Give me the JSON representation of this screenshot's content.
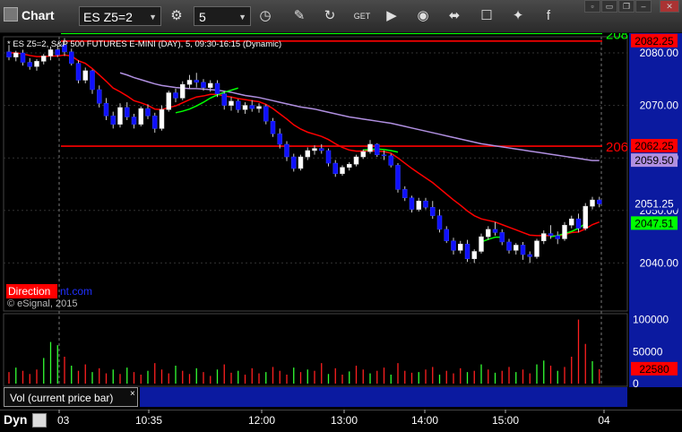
{
  "toolbar": {
    "title": "Chart",
    "symbol": "ES Z5=2",
    "interval": "5",
    "buttons": [
      {
        "name": "settings-icon",
        "glyph": "⚙"
      },
      {
        "name": "clock-icon",
        "glyph": "◷"
      },
      {
        "name": "pencil-icon",
        "glyph": "✎"
      },
      {
        "name": "refresh-icon",
        "glyph": "↻"
      },
      {
        "name": "get-icon",
        "glyph": "GET"
      },
      {
        "name": "play-icon",
        "glyph": "▶"
      },
      {
        "name": "camera-icon",
        "glyph": "◉"
      },
      {
        "name": "link-icon",
        "glyph": "⬌"
      },
      {
        "name": "comment-icon",
        "glyph": "☐"
      },
      {
        "name": "twitter-icon",
        "glyph": "✦"
      },
      {
        "name": "facebook-icon",
        "glyph": "f"
      }
    ]
  },
  "colors": {
    "price_axis_bg": "#0b1aa0",
    "red_line": "#ff0000",
    "green_line": "#00ff00",
    "purple_line": "#b08fe0",
    "candle_up": "#ffffff",
    "candle_down": "#1010ff"
  },
  "chart_data": {
    "type": "candlestick",
    "title": "* ES Z5=2, S&P 500 FUTURES E-MINI (DAY), 5, 09:30-16:15 (Dynamic)",
    "watermark": "© eSignal, 2015",
    "branding": "Direction",
    "branding_suffix": "nt.com",
    "x_ticks": [
      "03",
      "10:35",
      "12:00",
      "13:00",
      "14:00",
      "15:00",
      "04"
    ],
    "y_ticks": [
      "2080.00",
      "2070.00",
      "2060.00",
      "2050.00",
      "2040.00"
    ],
    "ylim": [
      2038,
      2085
    ],
    "horizontal_lines": [
      {
        "value": 2083.7,
        "color": "#00ff00",
        "label": "208"
      },
      {
        "value": 2082.25,
        "color": "#ff0000",
        "label": "2082.25"
      },
      {
        "value": 2062.25,
        "color": "#ff0000",
        "label": "206"
      }
    ],
    "price_labels": [
      {
        "text": "2082.25",
        "value": 2082.25,
        "bg": "#ff0000",
        "fg": "#000000"
      },
      {
        "text": "2062.25",
        "value": 2062.25,
        "bg": "#ff0000",
        "fg": "#000000"
      },
      {
        "text": "2059.50",
        "value": 2059.5,
        "bg": "#b08fe0",
        "fg": "#000000"
      },
      {
        "text": "2051.25",
        "value": 2051.25,
        "bg": "#0b1aa0",
        "fg": "#ffffff"
      },
      {
        "text": "2047.51",
        "value": 2047.51,
        "bg": "#00ff00",
        "fg": "#000000"
      }
    ],
    "candles": [
      [
        2080.2,
        2081.5,
        2078.6,
        2079.2
      ],
      [
        2079.2,
        2080.4,
        2078.4,
        2080.0
      ],
      [
        2080.0,
        2080.6,
        2077.6,
        2078.2
      ],
      [
        2078.2,
        2079.0,
        2076.8,
        2077.4
      ],
      [
        2077.4,
        2078.8,
        2076.6,
        2078.4
      ],
      [
        2078.4,
        2079.8,
        2077.8,
        2079.4
      ],
      [
        2079.4,
        2081.2,
        2078.6,
        2080.6
      ],
      [
        2080.6,
        2081.4,
        2079.2,
        2079.6
      ],
      [
        2081.5,
        2082.8,
        2079.4,
        2080.2
      ],
      [
        2080.2,
        2080.8,
        2077.6,
        2078.0
      ],
      [
        2078.0,
        2078.6,
        2074.2,
        2074.8
      ],
      [
        2074.8,
        2077.2,
        2074.2,
        2076.6
      ],
      [
        2076.6,
        2076.8,
        2072.2,
        2073.0
      ],
      [
        2073.0,
        2073.8,
        2069.6,
        2070.4
      ],
      [
        2070.4,
        2071.4,
        2067.2,
        2068.0
      ],
      [
        2068.0,
        2068.8,
        2065.6,
        2066.4
      ],
      [
        2066.4,
        2070.4,
        2065.8,
        2069.6
      ],
      [
        2069.6,
        2070.6,
        2067.2,
        2067.8
      ],
      [
        2067.8,
        2068.4,
        2065.6,
        2066.4
      ],
      [
        2066.4,
        2069.8,
        2066.0,
        2069.4
      ],
      [
        2069.4,
        2070.2,
        2067.4,
        2068.0
      ],
      [
        2068.0,
        2068.6,
        2064.8,
        2065.6
      ],
      [
        2065.6,
        2070.0,
        2065.2,
        2069.2
      ],
      [
        2069.2,
        2072.8,
        2068.8,
        2072.4
      ],
      [
        2072.4,
        2073.2,
        2070.6,
        2071.4
      ],
      [
        2071.4,
        2074.6,
        2071.0,
        2074.0
      ],
      [
        2074.0,
        2075.8,
        2073.2,
        2074.8
      ],
      [
        2074.8,
        2076.2,
        2073.4,
        2074.4
      ],
      [
        2074.4,
        2075.0,
        2072.8,
        2073.4
      ],
      [
        2073.4,
        2074.8,
        2072.6,
        2074.2
      ],
      [
        2074.2,
        2074.8,
        2071.6,
        2072.2
      ],
      [
        2072.2,
        2072.6,
        2069.2,
        2070.0
      ],
      [
        2070.0,
        2071.6,
        2069.0,
        2070.8
      ],
      [
        2070.8,
        2071.2,
        2068.6,
        2069.2
      ],
      [
        2069.2,
        2070.6,
        2068.4,
        2070.0
      ],
      [
        2070.0,
        2071.0,
        2068.8,
        2069.4
      ],
      [
        2069.4,
        2070.4,
        2068.6,
        2069.8
      ],
      [
        2069.8,
        2070.2,
        2066.4,
        2067.0
      ],
      [
        2067.0,
        2067.6,
        2064.0,
        2064.6
      ],
      [
        2064.6,
        2065.6,
        2061.8,
        2062.6
      ],
      [
        2062.6,
        2063.2,
        2059.4,
        2060.2
      ],
      [
        2060.2,
        2060.8,
        2057.4,
        2058.0
      ],
      [
        2058.0,
        2060.6,
        2057.6,
        2060.2
      ],
      [
        2060.2,
        2062.0,
        2059.6,
        2061.4
      ],
      [
        2061.4,
        2062.4,
        2060.6,
        2061.8
      ],
      [
        2061.8,
        2062.6,
        2060.8,
        2061.4
      ],
      [
        2061.4,
        2061.8,
        2058.4,
        2059.0
      ],
      [
        2059.0,
        2059.6,
        2056.4,
        2057.0
      ],
      [
        2057.0,
        2058.6,
        2056.6,
        2058.2
      ],
      [
        2058.2,
        2059.2,
        2057.6,
        2058.8
      ],
      [
        2058.8,
        2060.6,
        2058.4,
        2060.2
      ],
      [
        2060.2,
        2061.6,
        2059.8,
        2061.2
      ],
      [
        2061.2,
        2063.4,
        2060.8,
        2062.6
      ],
      [
        2062.6,
        2062.8,
        2060.2,
        2060.6
      ],
      [
        2060.6,
        2061.4,
        2059.6,
        2060.4
      ],
      [
        2060.4,
        2060.8,
        2058.2,
        2058.6
      ],
      [
        2058.6,
        2059.0,
        2053.4,
        2054.0
      ],
      [
        2054.0,
        2054.6,
        2051.8,
        2052.4
      ],
      [
        2052.4,
        2052.8,
        2049.6,
        2050.2
      ],
      [
        2050.2,
        2052.4,
        2049.8,
        2051.8
      ],
      [
        2051.8,
        2052.4,
        2050.2,
        2050.6
      ],
      [
        2050.6,
        2051.8,
        2048.4,
        2049.0
      ],
      [
        2049.0,
        2050.2,
        2045.8,
        2046.4
      ],
      [
        2046.4,
        2047.0,
        2043.8,
        2044.2
      ],
      [
        2044.2,
        2044.8,
        2041.6,
        2042.4
      ],
      [
        2042.4,
        2044.2,
        2041.8,
        2043.6
      ],
      [
        2043.6,
        2044.4,
        2040.2,
        2040.8
      ],
      [
        2040.8,
        2042.6,
        2040.0,
        2042.2
      ],
      [
        2042.2,
        2045.6,
        2041.8,
        2045.0
      ],
      [
        2045.0,
        2047.0,
        2044.4,
        2046.4
      ],
      [
        2046.4,
        2047.8,
        2045.2,
        2045.8
      ],
      [
        2045.8,
        2046.4,
        2043.4,
        2044.0
      ],
      [
        2044.0,
        2044.6,
        2041.8,
        2042.4
      ],
      [
        2042.4,
        2043.8,
        2041.6,
        2043.4
      ],
      [
        2043.4,
        2044.0,
        2040.6,
        2041.6
      ],
      [
        2041.6,
        2042.2,
        2040.0,
        2041.2
      ],
      [
        2041.2,
        2044.6,
        2040.8,
        2044.2
      ],
      [
        2044.2,
        2046.2,
        2043.6,
        2045.6
      ],
      [
        2045.6,
        2047.2,
        2044.6,
        2045.2
      ],
      [
        2045.2,
        2046.0,
        2043.6,
        2044.6
      ],
      [
        2044.6,
        2047.8,
        2044.2,
        2047.2
      ],
      [
        2047.2,
        2049.0,
        2046.6,
        2048.4
      ],
      [
        2048.4,
        2049.4,
        2045.8,
        2046.6
      ],
      [
        2046.6,
        2051.4,
        2046.2,
        2050.8
      ],
      [
        2050.8,
        2052.6,
        2050.2,
        2052.0
      ],
      [
        2052.0,
        2052.6,
        2050.6,
        2051.25
      ]
    ],
    "ema_red": [
      2080.0,
      2080.0,
      2079.8,
      2079.5,
      2079.3,
      2079.3,
      2079.4,
      2079.4,
      2079.6,
      2079.4,
      2078.5,
      2078.0,
      2077.0,
      2075.8,
      2074.6,
      2073.3,
      2072.6,
      2071.8,
      2070.9,
      2070.5,
      2070.0,
      2069.3,
      2069.2,
      2069.6,
      2069.9,
      2070.5,
      2071.1,
      2071.6,
      2071.8,
      2072.1,
      2072.1,
      2071.8,
      2071.6,
      2071.3,
      2071.1,
      2070.9,
      2070.7,
      2070.2,
      2069.4,
      2068.4,
      2067.4,
      2066.3,
      2065.5,
      2064.9,
      2064.5,
      2064.1,
      2063.5,
      2062.7,
      2062.0,
      2061.5,
      2061.3,
      2061.3,
      2061.4,
      2061.3,
      2061.2,
      2060.9,
      2060.0,
      2059.0,
      2058.0,
      2057.1,
      2056.2,
      2055.3,
      2054.2,
      2053.1,
      2052.0,
      2051.0,
      2049.9,
      2049.0,
      2048.4,
      2048.1,
      2047.8,
      2047.3,
      2046.8,
      2046.3,
      2045.8,
      2045.3,
      2045.2,
      2045.2,
      2045.2,
      2045.1,
      2045.4,
      2045.8,
      2045.9,
      2046.5,
      2047.3,
      2047.8
    ],
    "ma_purple": [
      null,
      null,
      null,
      null,
      null,
      null,
      null,
      null,
      null,
      null,
      null,
      null,
      null,
      null,
      null,
      null,
      2076.2,
      2075.8,
      2075.3,
      2074.9,
      2074.5,
      2074.1,
      2073.8,
      2073.6,
      2073.4,
      2073.3,
      2073.2,
      2073.2,
      2073.1,
      2073.0,
      2072.9,
      2072.7,
      2072.5,
      2072.2,
      2071.9,
      2071.7,
      2071.5,
      2071.2,
      2070.9,
      2070.6,
      2070.3,
      2070.0,
      2069.7,
      2069.5,
      2069.3,
      2069.0,
      2068.7,
      2068.4,
      2068.1,
      2067.8,
      2067.6,
      2067.4,
      2067.2,
      2067.0,
      2066.8,
      2066.6,
      2066.3,
      2066.0,
      2065.7,
      2065.4,
      2065.1,
      2064.8,
      2064.5,
      2064.2,
      2063.9,
      2063.6,
      2063.3,
      2063.0,
      2062.7,
      2062.5,
      2062.3,
      2062.1,
      2061.9,
      2061.7,
      2061.5,
      2061.3,
      2061.1,
      2060.9,
      2060.7,
      2060.5,
      2060.3,
      2060.1,
      2059.9,
      2059.7,
      2059.5,
      2059.5
    ],
    "green_overlay": [
      {
        "start": 24,
        "values": [
          2068.6,
          2068.9,
          2069.3,
          2069.9,
          2070.6,
          2071.4,
          2072.0,
          2072.5,
          2072.9,
          2073.3
        ]
      },
      {
        "start": 51,
        "values": [
          2061.5,
          2061.6,
          2061.7,
          2061.6,
          2061.4,
          2061.1
        ]
      },
      {
        "start": 68,
        "values": [
          2044.0,
          2044.5,
          2044.9,
          2044.9
        ]
      },
      {
        "start": 78,
        "values": [
          2045.0,
          2045.2,
          2045.6,
          2046.0,
          2046.6,
          2047.51
        ]
      }
    ],
    "volume": {
      "y_ticks": [
        "100000",
        "50000",
        "0"
      ],
      "ylim": [
        0,
        105000
      ],
      "last_label": "22580",
      "values": [
        [
          18000,
          "r"
        ],
        [
          25000,
          "g"
        ],
        [
          20000,
          "r"
        ],
        [
          15000,
          "r"
        ],
        [
          22000,
          "r"
        ],
        [
          40000,
          "g"
        ],
        [
          65000,
          "g"
        ],
        [
          60000,
          "g"
        ],
        [
          42000,
          "r"
        ],
        [
          28000,
          "g"
        ],
        [
          20000,
          "r"
        ],
        [
          30000,
          "r"
        ],
        [
          18000,
          "g"
        ],
        [
          24000,
          "r"
        ],
        [
          16000,
          "r"
        ],
        [
          22000,
          "g"
        ],
        [
          15000,
          "r"
        ],
        [
          25000,
          "g"
        ],
        [
          18000,
          "r"
        ],
        [
          14000,
          "r"
        ],
        [
          20000,
          "g"
        ],
        [
          32000,
          "r"
        ],
        [
          22000,
          "r"
        ],
        [
          16000,
          "r"
        ],
        [
          28000,
          "g"
        ],
        [
          20000,
          "r"
        ],
        [
          15000,
          "r"
        ],
        [
          24000,
          "g"
        ],
        [
          18000,
          "r"
        ],
        [
          12000,
          "r"
        ],
        [
          22000,
          "g"
        ],
        [
          30000,
          "r"
        ],
        [
          17000,
          "r"
        ],
        [
          20000,
          "g"
        ],
        [
          14000,
          "r"
        ],
        [
          24000,
          "r"
        ],
        [
          16000,
          "r"
        ],
        [
          18000,
          "g"
        ],
        [
          26000,
          "r"
        ],
        [
          20000,
          "r"
        ],
        [
          14000,
          "r"
        ],
        [
          25000,
          "g"
        ],
        [
          18000,
          "r"
        ],
        [
          22000,
          "g"
        ],
        [
          20000,
          "r"
        ],
        [
          32000,
          "r"
        ],
        [
          15000,
          "g"
        ],
        [
          24000,
          "r"
        ],
        [
          14000,
          "r"
        ],
        [
          19000,
          "g"
        ],
        [
          28000,
          "r"
        ],
        [
          22000,
          "r"
        ],
        [
          16000,
          "g"
        ],
        [
          20000,
          "r"
        ],
        [
          25000,
          "r"
        ],
        [
          14000,
          "g"
        ],
        [
          32000,
          "r"
        ],
        [
          20000,
          "r"
        ],
        [
          17000,
          "r"
        ],
        [
          18000,
          "g"
        ],
        [
          22000,
          "r"
        ],
        [
          26000,
          "r"
        ],
        [
          14000,
          "g"
        ],
        [
          20000,
          "r"
        ],
        [
          16000,
          "r"
        ],
        [
          24000,
          "r"
        ],
        [
          18000,
          "g"
        ],
        [
          20000,
          "r"
        ],
        [
          30000,
          "g"
        ],
        [
          22000,
          "r"
        ],
        [
          17000,
          "g"
        ],
        [
          20000,
          "r"
        ],
        [
          26000,
          "r"
        ],
        [
          18000,
          "g"
        ],
        [
          22000,
          "r"
        ],
        [
          16000,
          "r"
        ],
        [
          30000,
          "g"
        ],
        [
          36000,
          "g"
        ],
        [
          28000,
          "r"
        ],
        [
          20000,
          "g"
        ],
        [
          26000,
          "r"
        ],
        [
          42000,
          "r"
        ],
        [
          100000,
          "r"
        ],
        [
          62000,
          "r"
        ],
        [
          35000,
          "g"
        ],
        [
          22580,
          "r"
        ]
      ]
    }
  },
  "volume_bar": {
    "label": "Vol (current price bar)",
    "close": "×"
  },
  "bottom": {
    "dyn": "Dyn"
  }
}
